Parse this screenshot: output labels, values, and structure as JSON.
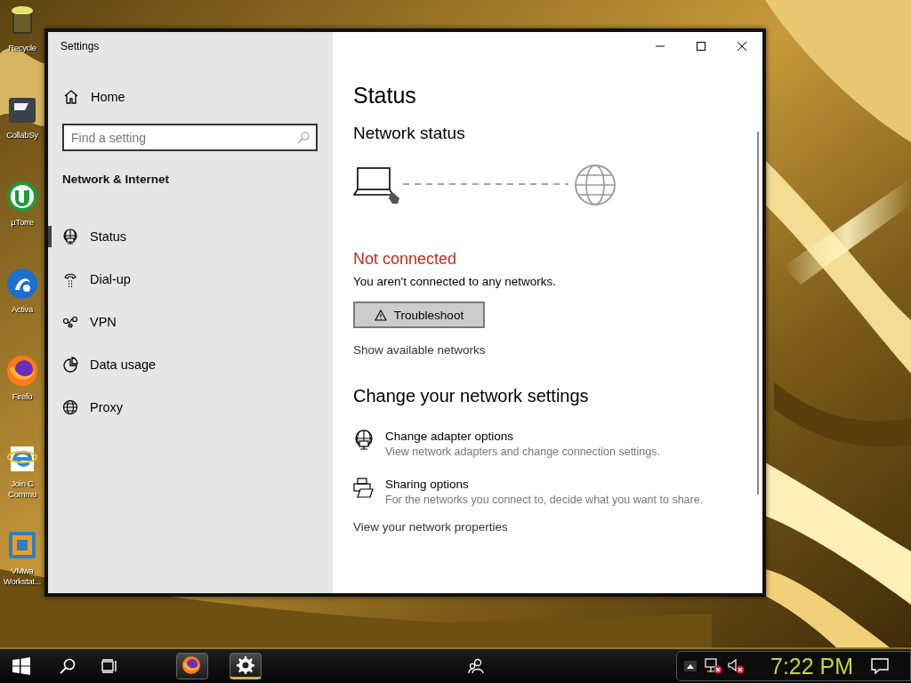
{
  "desktop_icons": [
    {
      "lines": [
        "Recycle"
      ]
    },
    {
      "lines": [
        "CollabSy"
      ]
    },
    {
      "lines": [
        "µTorre"
      ]
    },
    {
      "lines": [
        "Activa"
      ]
    },
    {
      "lines": [
        "Firefo"
      ]
    },
    {
      "lines": [
        "Join C",
        "Commu"
      ]
    },
    {
      "lines": [
        "VMwa",
        "Workstat..."
      ]
    }
  ],
  "window": {
    "title": "Settings"
  },
  "sidebar": {
    "home": "Home",
    "search": {
      "placeholder": "Find a setting"
    },
    "section": "Network & Internet",
    "items": [
      {
        "label": "Status",
        "selected": true
      },
      {
        "label": "Dial-up",
        "selected": false
      },
      {
        "label": "VPN",
        "selected": false
      },
      {
        "label": "Data usage",
        "selected": false
      },
      {
        "label": "Proxy",
        "selected": false
      }
    ]
  },
  "main": {
    "title": "Status",
    "network_status": {
      "heading": "Network status",
      "state": "Not connected",
      "description": "You aren't connected to any networks.",
      "troubleshoot_button": "Troubleshoot",
      "link": "Show available networks"
    },
    "change_settings": {
      "heading": "Change your network settings",
      "options": [
        {
          "title": "Change adapter options",
          "description": "View network adapters and change connection settings."
        },
        {
          "title": "Sharing options",
          "description": "For the networks you connect to, decide what you want to share."
        }
      ],
      "link": "View your network properties"
    }
  },
  "taskbar": {
    "apps": [
      {
        "selected": false
      },
      {
        "selected": true
      }
    ],
    "clock": "7:22 PM"
  }
}
